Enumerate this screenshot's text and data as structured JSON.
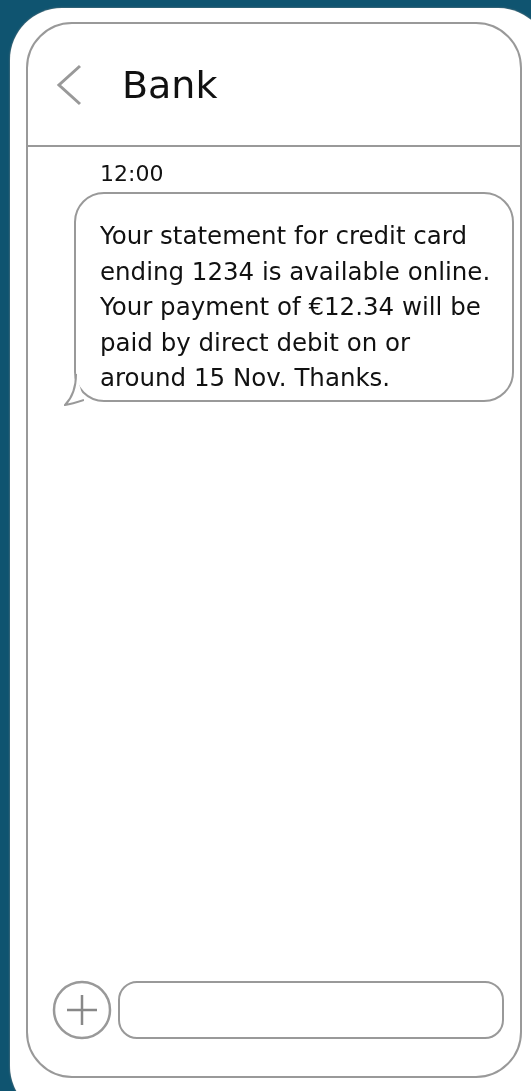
{
  "header": {
    "title": "Bank"
  },
  "messages": [
    {
      "time": "12:00",
      "text": "Your statement for credit card ending 1234 is available online. Your payment of €12.34 will be paid by direct debit on or around 15 Nov. Thanks."
    }
  ]
}
